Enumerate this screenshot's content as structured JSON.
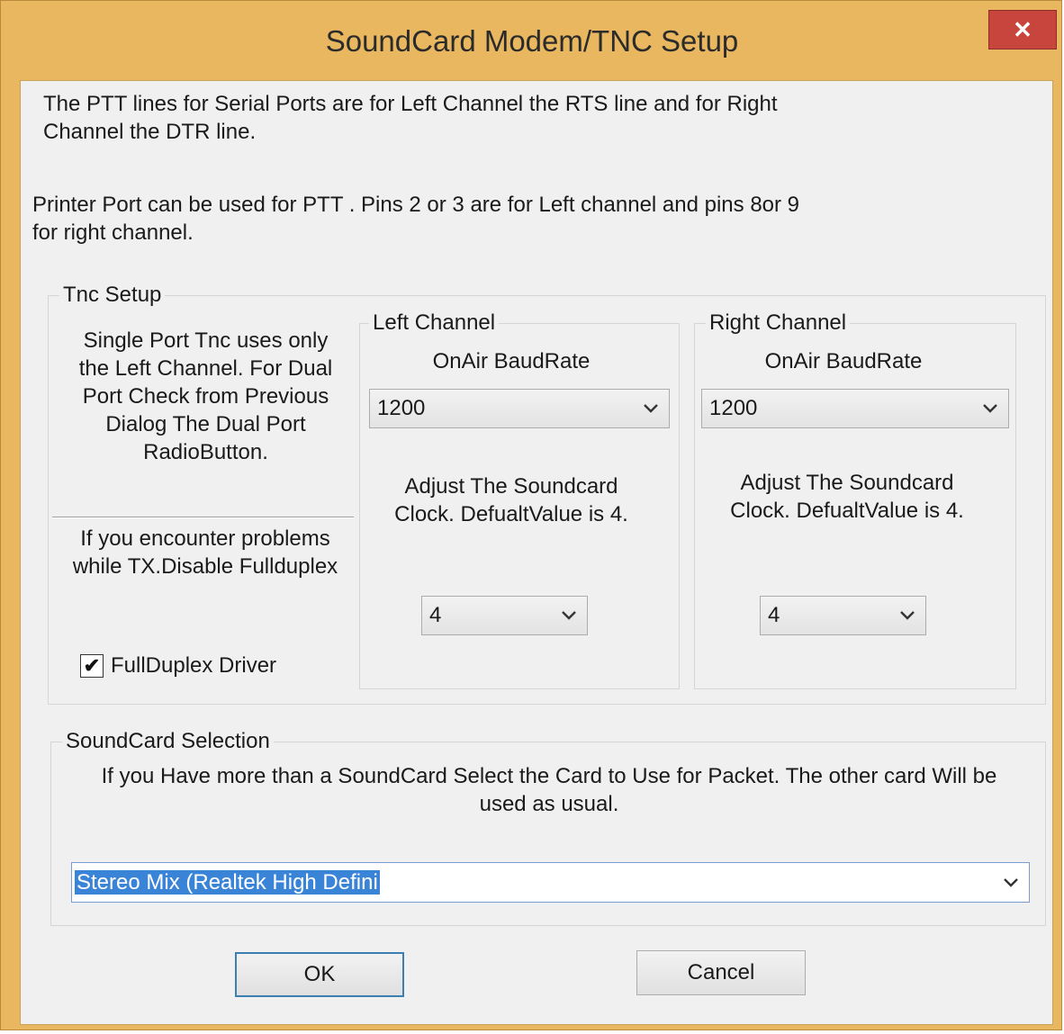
{
  "window": {
    "title": "SoundCard Modem/TNC Setup",
    "close_glyph": "✕"
  },
  "intro": {
    "ptt_serial_line1": "The PTT lines for Serial Ports are for Left Channel the RTS line and for Right",
    "ptt_serial_line2": "Channel the DTR line.",
    "printer_line1": "Printer Port can be used for PTT . Pins 2 or 3 are for Left channel and pins 8or 9",
    "printer_line2": "for right channel."
  },
  "tnc_setup": {
    "label": "Tnc Setup",
    "info_line1": "Single Port Tnc uses only",
    "info_line2": "the Left Channel. For Dual",
    "info_line3": "Port Check from Previous",
    "info_line4": "Dialog The Dual  Port",
    "info_line5": "RadioButton.",
    "problem_line1": "If you encounter problems",
    "problem_line2": "while TX.Disable Fullduplex",
    "fullduplex_label": "FullDuplex Driver",
    "fullduplex_checked": true,
    "check_glyph": "✔"
  },
  "left_channel": {
    "label": "Left Channel",
    "baud_label": "OnAir BaudRate",
    "baud_value": "1200",
    "clock_line1": "Adjust The Soundcard",
    "clock_line2": "Clock. DefualtValue is 4.",
    "clock_value": "4"
  },
  "right_channel": {
    "label": "Right Channel",
    "baud_label": "OnAir BaudRate",
    "baud_value": "1200",
    "clock_line1": "Adjust The Soundcard",
    "clock_line2": "Clock. DefualtValue is 4.",
    "clock_value": "4"
  },
  "soundcard": {
    "label": "SoundCard Selection",
    "info_line1": "If you Have more than a SoundCard Select the Card to Use for Packet. The other card Will be",
    "info_line2": "used as usual.",
    "selected": "Stereo Mix (Realtek High Defini"
  },
  "buttons": {
    "ok": "OK",
    "cancel": "Cancel"
  },
  "icons": {
    "chevron": "chevron-down-icon",
    "check": "checkmark-icon",
    "close": "close-icon"
  },
  "colors": {
    "title_bar": "#e9b760",
    "close_button": "#c7453c",
    "selection": "#3a84d8",
    "dialog_bg": "#f0f0f0"
  }
}
